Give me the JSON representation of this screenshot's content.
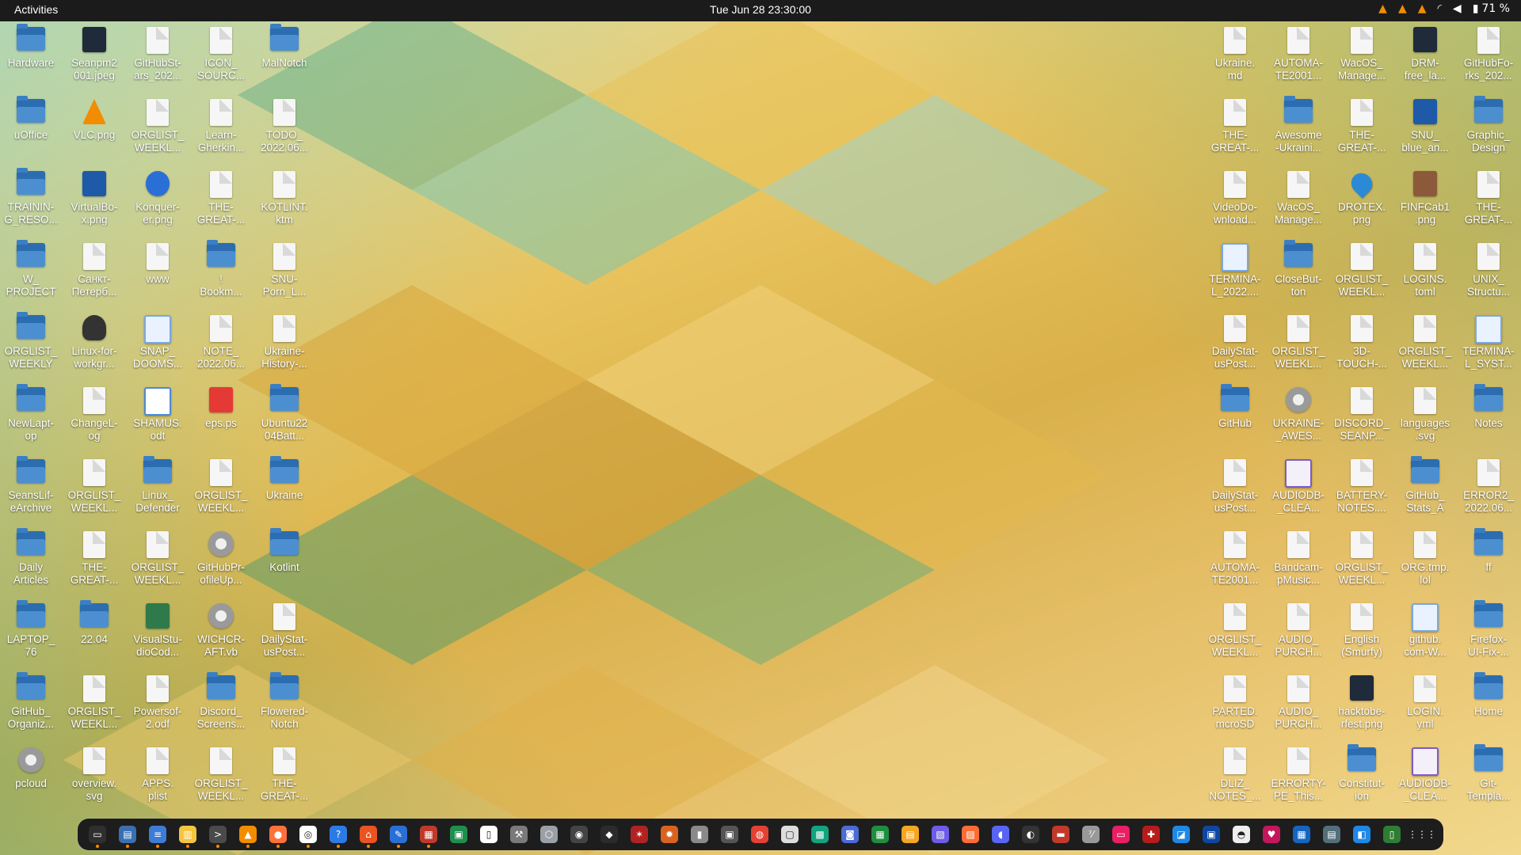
{
  "topbar": {
    "activities": "Activities",
    "clock": "Tue Jun 28  23:30:00",
    "battery_percent": "71 %",
    "tray_icons": [
      "vlc-icon",
      "vlc-icon",
      "vlc-icon",
      "wifi-icon",
      "volume-icon",
      "battery-icon"
    ]
  },
  "desktop": {
    "left": [
      {
        "label": "Hardware",
        "icon": "folder"
      },
      {
        "label": "Seanpm2\n001.jpeg",
        "icon": "image-dark"
      },
      {
        "label": "GitHubSt-\nars_202...",
        "icon": "doc"
      },
      {
        "label": "ICON_\nSOURC...",
        "icon": "doc"
      },
      {
        "label": "MalNotch",
        "icon": "folder"
      },
      {
        "label": "uOffice",
        "icon": "folder"
      },
      {
        "label": "VLC.png",
        "icon": "vlc"
      },
      {
        "label": "ORGLIST_\nWEEKL...",
        "icon": "doc"
      },
      {
        "label": "Learn-\nGherkin...",
        "icon": "doc"
      },
      {
        "label": "TODO_\n2022.06...",
        "icon": "doc"
      },
      {
        "label": "TRAININ-\nG_RESO...",
        "icon": "folder"
      },
      {
        "label": "VirtualBo-\nx.png",
        "icon": "image-blue"
      },
      {
        "label": "Konquer-\ner.png",
        "icon": "globe"
      },
      {
        "label": "THE-\nGREAT-...",
        "icon": "doc"
      },
      {
        "label": "KOTLINT.\nktm",
        "icon": "doc"
      },
      {
        "label": "W_\nPROJECT",
        "icon": "folder"
      },
      {
        "label": "Санкт-\nПетерб...",
        "icon": "doc"
      },
      {
        "label": "www",
        "icon": "doc"
      },
      {
        "label": "!\nBookm...",
        "icon": "folder"
      },
      {
        "label": "SNU-\nPorn_L...",
        "icon": "doc"
      },
      {
        "label": "ORGLIST_\nWEEKLY",
        "icon": "folder"
      },
      {
        "label": "Linux-for-\nworkgr...",
        "icon": "tux"
      },
      {
        "label": "SNAP_\nDOOMS...",
        "icon": "code"
      },
      {
        "label": "NOTE_\n2022.06...",
        "icon": "doc"
      },
      {
        "label": "Ukraine-\nHistory-...",
        "icon": "doc"
      },
      {
        "label": "NewLapt-\nop",
        "icon": "folder"
      },
      {
        "label": "ChangeL-\nog",
        "icon": "doc"
      },
      {
        "label": "SHAMUS.\nodt",
        "icon": "text"
      },
      {
        "label": "eps.ps",
        "icon": "image-red"
      },
      {
        "label": "Ubuntu22\n04Batt...",
        "icon": "folder"
      },
      {
        "label": "SeansLif-\neArchive",
        "icon": "folder"
      },
      {
        "label": "ORGLIST_\nWEEKL...",
        "icon": "doc"
      },
      {
        "label": "Linux_\nDefender",
        "icon": "folder"
      },
      {
        "label": "ORGLIST_\nWEEKL...",
        "icon": "doc"
      },
      {
        "label": "Ukraine",
        "icon": "folder"
      },
      {
        "label": "Daily\nArticles",
        "icon": "folder"
      },
      {
        "label": "THE-\nGREAT-...",
        "icon": "doc"
      },
      {
        "label": "ORGLIST_\nWEEKL...",
        "icon": "doc"
      },
      {
        "label": "GitHubPr-\nofileUp...",
        "icon": "gear"
      },
      {
        "label": "Kotlint",
        "icon": "folder"
      },
      {
        "label": "LAPTOP_\n76",
        "icon": "folder"
      },
      {
        "label": "22.04",
        "icon": "folder"
      },
      {
        "label": "VisualStu-\ndioCod...",
        "icon": "image-green"
      },
      {
        "label": "WICHCR-\nAFT.vb",
        "icon": "gear"
      },
      {
        "label": "DailyStat-\nusPost...",
        "icon": "doc"
      },
      {
        "label": "GitHub_\nOrganiz...",
        "icon": "folder"
      },
      {
        "label": "ORGLIST_\nWEEKL...",
        "icon": "doc"
      },
      {
        "label": "Powersof-\n2.odf",
        "icon": "doc"
      },
      {
        "label": "Discord_\nScreens...",
        "icon": "folder"
      },
      {
        "label": "Flowered-\nNotch",
        "icon": "folder"
      },
      {
        "label": "pcloud",
        "icon": "gear"
      },
      {
        "label": "overview.\nsvg",
        "icon": "doc"
      },
      {
        "label": "APPS.\nplist",
        "icon": "doc"
      },
      {
        "label": "ORGLIST_\nWEEKL...",
        "icon": "doc"
      },
      {
        "label": "THE-\nGREAT-...",
        "icon": "doc"
      }
    ],
    "right": [
      {
        "label": "Ukraine.\nmd",
        "icon": "doc"
      },
      {
        "label": "AUTOMA-\nTE2001...",
        "icon": "doc"
      },
      {
        "label": "WacOS_\nManage...",
        "icon": "doc"
      },
      {
        "label": "DRM-\nfree_la...",
        "icon": "image-dark"
      },
      {
        "label": "GitHubFo-\nrks_202...",
        "icon": "doc"
      },
      {
        "label": "THE-\nGREAT-...",
        "icon": "doc"
      },
      {
        "label": "Awesome\n-Ukraini...",
        "icon": "folder"
      },
      {
        "label": "THE-\nGREAT-...",
        "icon": "doc"
      },
      {
        "label": "SNU_\nblue_an...",
        "icon": "image-blue"
      },
      {
        "label": "Graphic_\nDesign",
        "icon": "folder"
      },
      {
        "label": "VideoDo-\nwnload...",
        "icon": "doc"
      },
      {
        "label": "WacOS_\nManage...",
        "icon": "doc"
      },
      {
        "label": "DROTEX.\npng",
        "icon": "drop"
      },
      {
        "label": "FINFCab1\n.png",
        "icon": "cabinet"
      },
      {
        "label": "THE-\nGREAT-...",
        "icon": "doc"
      },
      {
        "label": "TERMINA-\nL_2022....",
        "icon": "code"
      },
      {
        "label": "CloseBut-\nton",
        "icon": "folder"
      },
      {
        "label": "ORGLIST_\nWEEKL...",
        "icon": "doc"
      },
      {
        "label": "LOGINS.\ntoml",
        "icon": "doc"
      },
      {
        "label": "UNIX_\nStructu...",
        "icon": "doc"
      },
      {
        "label": "DailyStat-\nusPost...",
        "icon": "doc"
      },
      {
        "label": "ORGLIST_\nWEEKL...",
        "icon": "doc"
      },
      {
        "label": "3D-\nTOUCH-...",
        "icon": "doc"
      },
      {
        "label": "ORGLIST_\nWEEKL...",
        "icon": "doc"
      },
      {
        "label": "TERMINA-\nL_SYST...",
        "icon": "code"
      },
      {
        "label": "GitHub",
        "icon": "folder"
      },
      {
        "label": "UKRAINE-\n_AWES...",
        "icon": "gear"
      },
      {
        "label": "DISCORD_\nSEANP...",
        "icon": "doc"
      },
      {
        "label": "languages\n.svg",
        "icon": "doc"
      },
      {
        "label": "Notes",
        "icon": "folder"
      },
      {
        "label": "DailyStat-\nusPost...",
        "icon": "doc"
      },
      {
        "label": "AUDIODB-\n_CLEA...",
        "icon": "purple"
      },
      {
        "label": "BATTERY-\nNOTES....",
        "icon": "doc"
      },
      {
        "label": "GitHub_\nStats_A",
        "icon": "folder"
      },
      {
        "label": "ERROR2_\n2022.06...",
        "icon": "doc"
      },
      {
        "label": "AUTOMA-\nTE2001...",
        "icon": "doc"
      },
      {
        "label": "Bandcam-\npMusic...",
        "icon": "doc"
      },
      {
        "label": "ORGLIST_\nWEEKL...",
        "icon": "doc"
      },
      {
        "label": "ORG.tmp.\nlol",
        "icon": "doc"
      },
      {
        "label": "ff",
        "icon": "folder"
      },
      {
        "label": "ORGLIST_\nWEEKL...",
        "icon": "doc"
      },
      {
        "label": "AUDIO_\nPURCH...",
        "icon": "doc"
      },
      {
        "label": "English\n(Smurfy)",
        "icon": "doc"
      },
      {
        "label": "github.\ncom-W...",
        "icon": "code"
      },
      {
        "label": "Firefox-\nUI-Fix-...",
        "icon": "folder"
      },
      {
        "label": "PARTED.\nmcroSD",
        "icon": "doc"
      },
      {
        "label": "AUDIO_\nPURCH...",
        "icon": "doc"
      },
      {
        "label": "hacktobe-\nrfest.png",
        "icon": "image-dark"
      },
      {
        "label": "LOGIN.\nyml",
        "icon": "doc"
      },
      {
        "label": "Home",
        "icon": "folder"
      },
      {
        "label": "DLIZ_\nNOTES_...",
        "icon": "doc"
      },
      {
        "label": "ERRORTY-\nPE_This...",
        "icon": "doc"
      },
      {
        "label": "Constitut-\nion",
        "icon": "folder"
      },
      {
        "label": "AUDIODB-\n_CLEA...",
        "icon": "purple"
      },
      {
        "label": "Git-\nTempla...",
        "icon": "folder"
      }
    ]
  },
  "dock": {
    "items": [
      {
        "name": "terminal-icon",
        "color": "#2f2f2f",
        "glyph": "▭"
      },
      {
        "name": "files-icon",
        "color": "#3a6fb0",
        "glyph": "▤"
      },
      {
        "name": "text-editor-icon",
        "color": "#3d7bd6",
        "glyph": "≡"
      },
      {
        "name": "notes-icon",
        "color": "#f5c542",
        "glyph": "▥"
      },
      {
        "name": "console-icon",
        "color": "#4a4a4a",
        "glyph": ">"
      },
      {
        "name": "vlc-icon",
        "color": "#f28c00",
        "glyph": "▲"
      },
      {
        "name": "firefox-icon",
        "color": "#ff7139",
        "glyph": "●"
      },
      {
        "name": "settings-icon",
        "color": "#ffffff",
        "glyph": "◎"
      },
      {
        "name": "help-icon",
        "color": "#2c7be5",
        "glyph": "?"
      },
      {
        "name": "software-icon",
        "color": "#e95420",
        "glyph": "⌂"
      },
      {
        "name": "writer-icon",
        "color": "#2a6fd6",
        "glyph": "✎"
      },
      {
        "name": "image-viewer-icon",
        "color": "#c0392b",
        "glyph": "▦"
      },
      {
        "name": "calc-icon",
        "color": "#1f8f4d",
        "glyph": "▣"
      },
      {
        "name": "doc-icon",
        "color": "#ffffff",
        "glyph": "▯"
      },
      {
        "name": "tool-icon",
        "color": "#7a7a7a",
        "glyph": "⚒"
      },
      {
        "name": "box-icon",
        "color": "#9aa0a6",
        "glyph": "⬡"
      },
      {
        "name": "obs-icon",
        "color": "#444444",
        "glyph": "◉"
      },
      {
        "name": "inkscape-icon",
        "color": "#2b2b2b",
        "glyph": "◆"
      },
      {
        "name": "app-icon",
        "color": "#b22222",
        "glyph": "✶"
      },
      {
        "name": "app2-icon",
        "color": "#d9631e",
        "glyph": "✹"
      },
      {
        "name": "app3-icon",
        "color": "#8a8a8a",
        "glyph": "▮"
      },
      {
        "name": "screenshot-icon",
        "color": "#555555",
        "glyph": "▣"
      },
      {
        "name": "chrome-icon",
        "color": "#e34133",
        "glyph": "◍"
      },
      {
        "name": "app4-icon",
        "color": "#dddddd",
        "glyph": "▢"
      },
      {
        "name": "app5-icon",
        "color": "#13a37e",
        "glyph": "▩"
      },
      {
        "name": "camera-icon",
        "color": "#4b6bd6",
        "glyph": "◙"
      },
      {
        "name": "sheets-icon",
        "color": "#1e8e3e",
        "glyph": "▦"
      },
      {
        "name": "app6-icon",
        "color": "#f5a623",
        "glyph": "▤"
      },
      {
        "name": "app7-icon",
        "color": "#6c5ce7",
        "glyph": "▧"
      },
      {
        "name": "app8-icon",
        "color": "#ff6b35",
        "glyph": "▨"
      },
      {
        "name": "discord-icon",
        "color": "#5865f2",
        "glyph": "◖"
      },
      {
        "name": "app9-icon",
        "color": "#333333",
        "glyph": "◐"
      },
      {
        "name": "app10-icon",
        "color": "#c0392b",
        "glyph": "▬"
      },
      {
        "name": "app11-icon",
        "color": "#999999",
        "glyph": "⁷⁄"
      },
      {
        "name": "app12-icon",
        "color": "#e91e63",
        "glyph": "▭"
      },
      {
        "name": "app13-icon",
        "color": "#b71c1c",
        "glyph": "✚"
      },
      {
        "name": "app14-icon",
        "color": "#1e88e5",
        "glyph": "◪"
      },
      {
        "name": "app15-icon",
        "color": "#0d47a1",
        "glyph": "▣"
      },
      {
        "name": "app16-icon",
        "color": "#eeeeee",
        "glyph": "◓"
      },
      {
        "name": "app17-icon",
        "color": "#c2185b",
        "glyph": "♥"
      },
      {
        "name": "app18-icon",
        "color": "#1565c0",
        "glyph": "▦"
      },
      {
        "name": "app19-icon",
        "color": "#546e7a",
        "glyph": "▤"
      },
      {
        "name": "app20-icon",
        "color": "#1e88e5",
        "glyph": "◧"
      },
      {
        "name": "trash-icon",
        "color": "#2e7d32",
        "glyph": "▯"
      },
      {
        "name": "app-grid-icon",
        "color": "#1d1d1d",
        "glyph": "⋮⋮⋮"
      }
    ]
  }
}
